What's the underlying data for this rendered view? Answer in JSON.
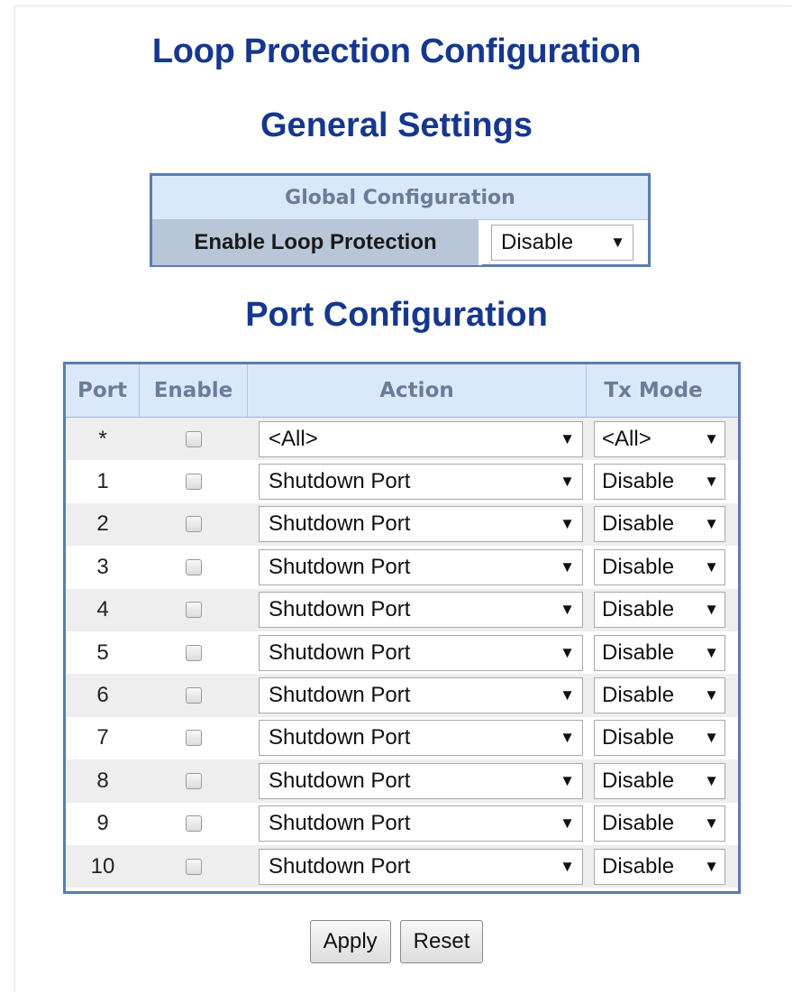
{
  "page_title": "Loop Protection Configuration",
  "general": {
    "title": "General Settings",
    "header": "Global Configuration",
    "label": "Enable Loop Protection",
    "value": "Disable"
  },
  "port_config": {
    "title": "Port Configuration",
    "columns": [
      "Port",
      "Enable",
      "Action",
      "Tx Mode"
    ],
    "rows": [
      {
        "port": "*",
        "enabled": false,
        "action": "<All>",
        "tx_mode": "<All>"
      },
      {
        "port": "1",
        "enabled": false,
        "action": "Shutdown Port",
        "tx_mode": "Disable"
      },
      {
        "port": "2",
        "enabled": false,
        "action": "Shutdown Port",
        "tx_mode": "Disable"
      },
      {
        "port": "3",
        "enabled": false,
        "action": "Shutdown Port",
        "tx_mode": "Disable"
      },
      {
        "port": "4",
        "enabled": false,
        "action": "Shutdown Port",
        "tx_mode": "Disable"
      },
      {
        "port": "5",
        "enabled": false,
        "action": "Shutdown Port",
        "tx_mode": "Disable"
      },
      {
        "port": "6",
        "enabled": false,
        "action": "Shutdown Port",
        "tx_mode": "Disable"
      },
      {
        "port": "7",
        "enabled": false,
        "action": "Shutdown Port",
        "tx_mode": "Disable"
      },
      {
        "port": "8",
        "enabled": false,
        "action": "Shutdown Port",
        "tx_mode": "Disable"
      },
      {
        "port": "9",
        "enabled": false,
        "action": "Shutdown Port",
        "tx_mode": "Disable"
      },
      {
        "port": "10",
        "enabled": false,
        "action": "Shutdown Port",
        "tx_mode": "Disable"
      }
    ]
  },
  "buttons": {
    "apply": "Apply",
    "reset": "Reset"
  },
  "colors": {
    "heading": "#15378f",
    "table_border": "#5a7db0",
    "header_bg": "#dbe8fa"
  }
}
